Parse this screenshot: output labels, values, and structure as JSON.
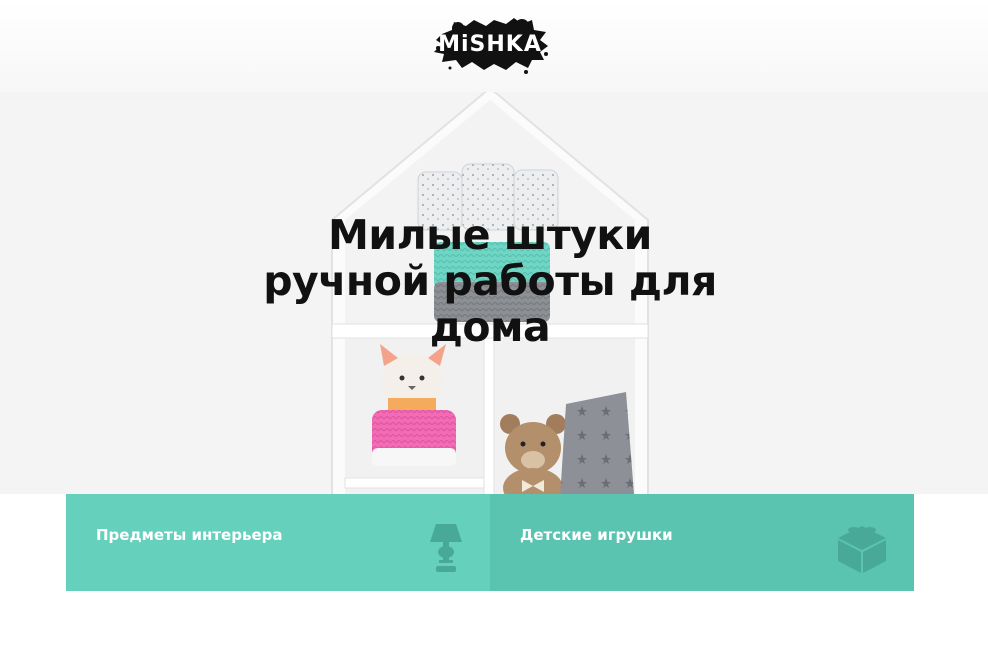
{
  "logo": {
    "text": "MiSHKA"
  },
  "hero": {
    "title": "Милые штуки ручной работы для дома"
  },
  "categories": [
    {
      "label": "Предметы интерьера",
      "icon": "lamp-icon",
      "bg": "#65d1bd"
    },
    {
      "label": "Детские игрушки",
      "icon": "cube-icon",
      "bg": "#5ac4b1"
    }
  ],
  "colors": {
    "accent": "#65d1bd",
    "accent_dark": "#5ac4b1",
    "icon": "#48a998"
  }
}
